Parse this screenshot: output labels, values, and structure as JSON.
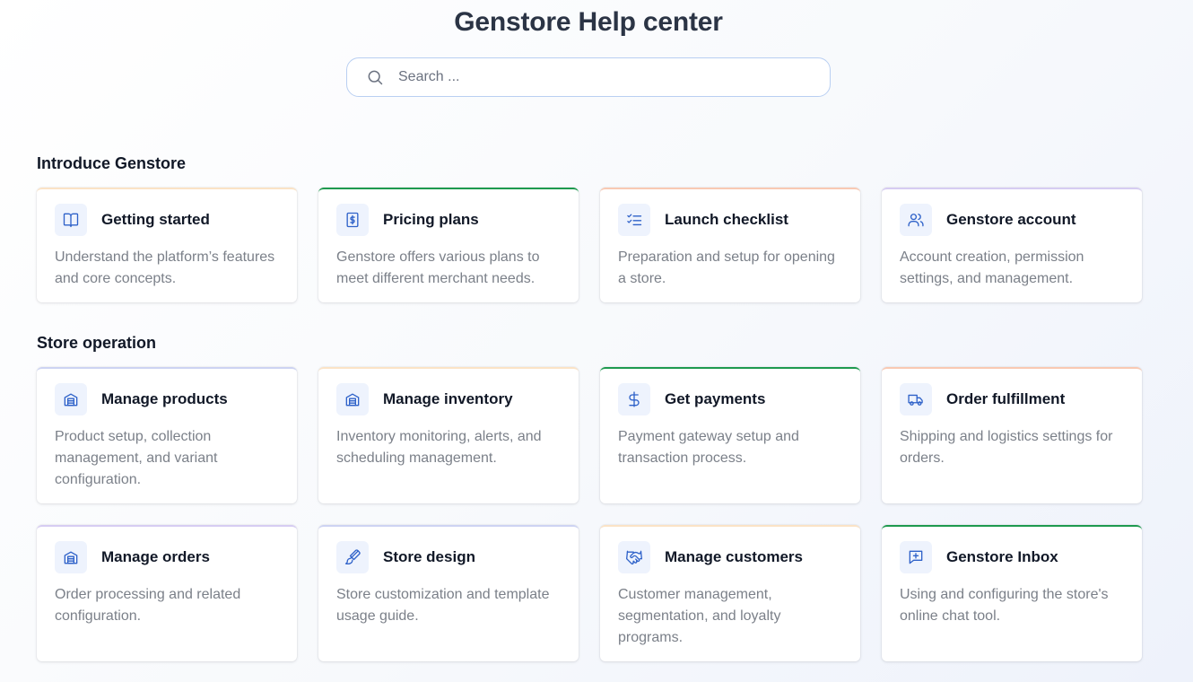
{
  "header": {
    "title": "Genstore Help center",
    "search_placeholder": "Search ..."
  },
  "sections": [
    {
      "title": "Introduce Genstore",
      "cards": [
        {
          "title": "Getting started",
          "desc": "Understand the platform’s features and core concepts.",
          "icon": "book-open-icon",
          "accent": "#fbe3c6"
        },
        {
          "title": "Pricing plans",
          "desc": "Genstore offers various plans to meet different merchant needs.",
          "icon": "dollar-receipt-icon",
          "accent": "#1e9a4f"
        },
        {
          "title": "Launch checklist",
          "desc": "Preparation and setup for opening a store.",
          "icon": "checklist-icon",
          "accent": "#f9c9b3"
        },
        {
          "title": "Genstore account",
          "desc": "Account creation, permission settings, and management.",
          "icon": "users-icon",
          "accent": "#d6ccf2"
        }
      ]
    },
    {
      "title": "Store operation",
      "cards": [
        {
          "title": "Manage products",
          "desc": "Product setup, collection management, and variant configuration.",
          "icon": "warehouse-icon",
          "accent": "#cdd3f2"
        },
        {
          "title": "Manage inventory",
          "desc": "Inventory monitoring, alerts, and scheduling management.",
          "icon": "warehouse-icon",
          "accent": "#fbe3c6"
        },
        {
          "title": "Get payments",
          "desc": "Payment gateway setup and transaction process.",
          "icon": "dollar-icon",
          "accent": "#1e9a4f"
        },
        {
          "title": "Order fulfillment",
          "desc": "Shipping and logistics settings for orders.",
          "icon": "truck-icon",
          "accent": "#f9c9b3"
        },
        {
          "title": "Manage orders",
          "desc": "Order processing and related configuration.",
          "icon": "warehouse-icon",
          "accent": "#d6ccf2"
        },
        {
          "title": "Store design",
          "desc": "Store customization and template usage guide.",
          "icon": "paintbrush-icon",
          "accent": "#cdd3f2"
        },
        {
          "title": "Manage customers",
          "desc": "Customer management, segmentation, and loyalty programs.",
          "icon": "handshake-icon",
          "accent": "#fbe3c6"
        },
        {
          "title": "Genstore Inbox",
          "desc": "Using and configuring the store's online chat tool.",
          "icon": "message-plus-icon",
          "accent": "#1e9a4f"
        }
      ]
    }
  ]
}
